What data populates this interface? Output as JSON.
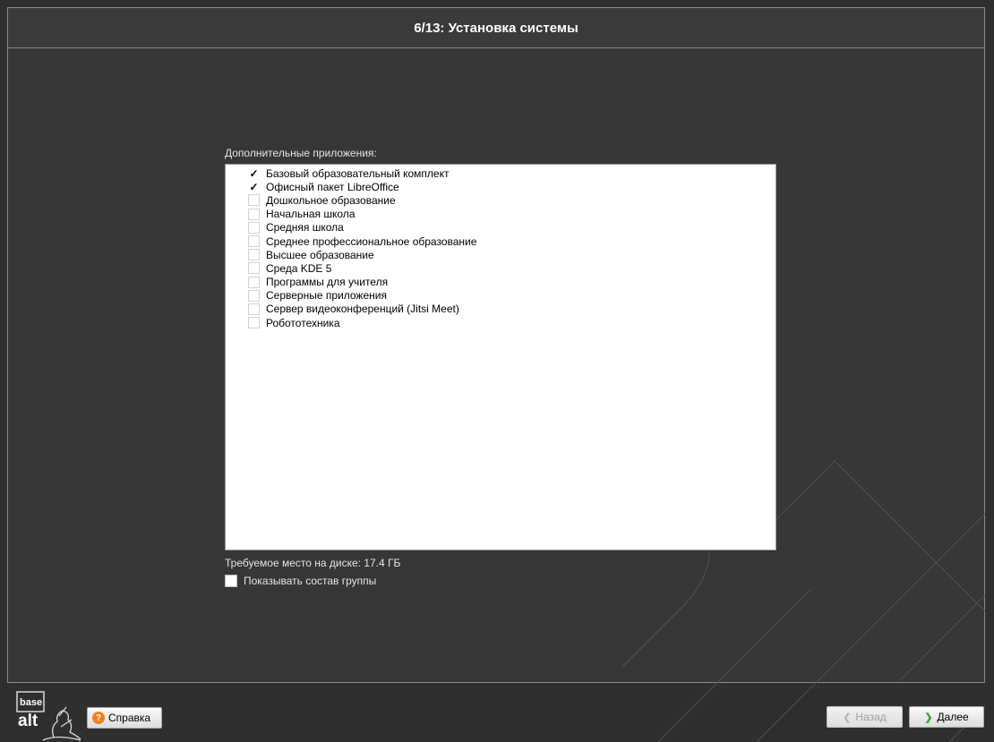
{
  "header": {
    "title": "6/13: Установка системы"
  },
  "apps": {
    "section_label": "Дополнительные приложения:",
    "items": [
      {
        "label": "Базовый образовательный комплект",
        "checked": true
      },
      {
        "label": "Офисный пакет LibreOffice",
        "checked": true
      },
      {
        "label": "Дошкольное образование",
        "checked": false
      },
      {
        "label": "Начальная школа",
        "checked": false
      },
      {
        "label": "Средняя школа",
        "checked": false
      },
      {
        "label": "Среднее профессиональное образование",
        "checked": false
      },
      {
        "label": "Высшее образование",
        "checked": false
      },
      {
        "label": "Среда KDE 5",
        "checked": false
      },
      {
        "label": "Программы для учителя",
        "checked": false
      },
      {
        "label": "Серверные приложения",
        "checked": false
      },
      {
        "label": "Сервер видеоконференций (Jitsi Meet)",
        "checked": false
      },
      {
        "label": "Робототехника",
        "checked": false
      }
    ],
    "check_mark": "✓"
  },
  "disk_space": "Требуемое место на диске: 17.4 ГБ",
  "show_group": {
    "label": "Показывать состав группы",
    "checked": false
  },
  "logo": {
    "line1": "base",
    "line2": "alt"
  },
  "footer": {
    "help_label": "Справка",
    "help_glyph": "?",
    "back_label": "Назад",
    "next_label": "Далее"
  },
  "icons": {
    "help": "help-icon",
    "back": "chevron-left-icon",
    "next": "chevron-right-icon"
  },
  "colors": {
    "accent_orange": "#f0821e",
    "next_arrow": "#3aa23a",
    "background": "#363636"
  }
}
